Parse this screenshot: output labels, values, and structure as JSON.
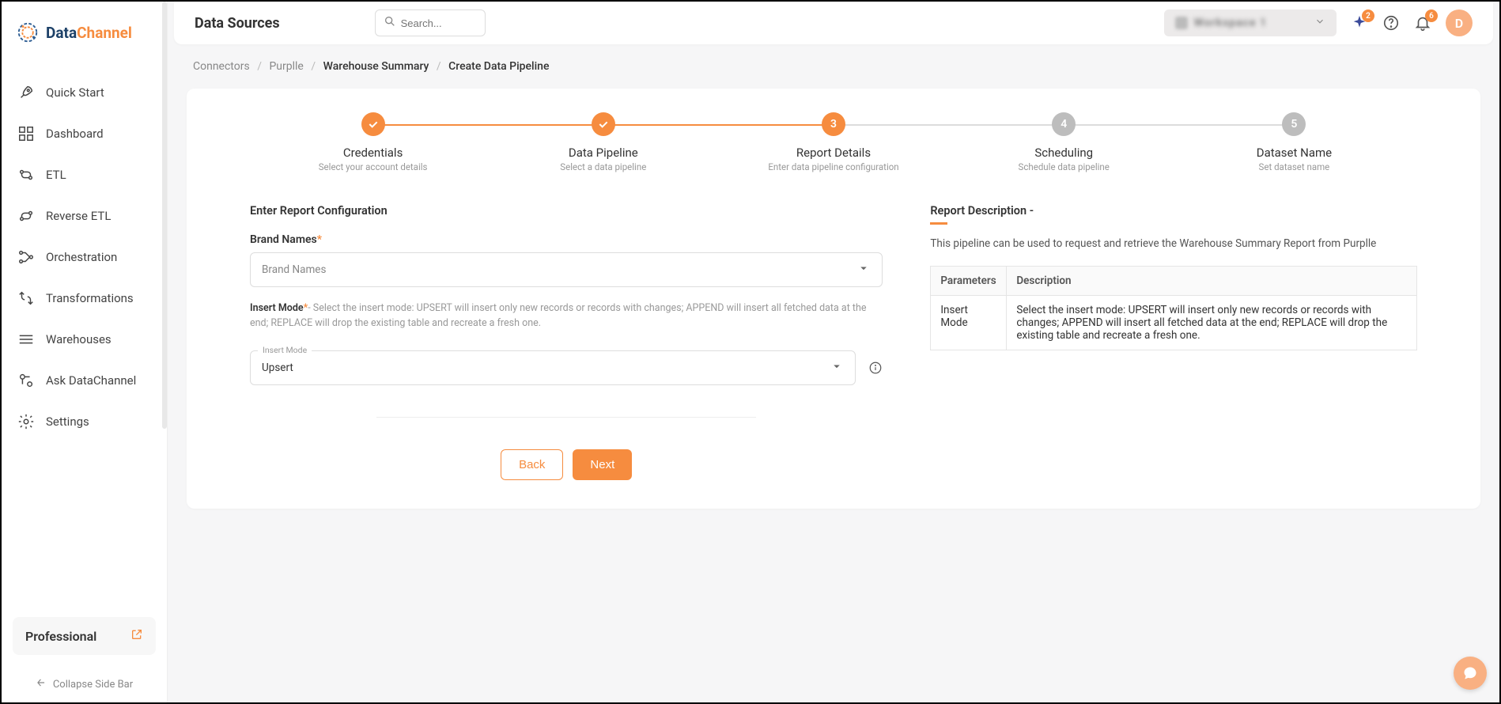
{
  "brand": {
    "first": "Data",
    "second": "Channel"
  },
  "sidebar": {
    "items": [
      {
        "label": "Quick Start"
      },
      {
        "label": "Dashboard"
      },
      {
        "label": "ETL"
      },
      {
        "label": "Reverse ETL"
      },
      {
        "label": "Orchestration"
      },
      {
        "label": "Transformations"
      },
      {
        "label": "Warehouses"
      },
      {
        "label": "Ask DataChannel"
      },
      {
        "label": "Settings"
      }
    ],
    "plan": "Professional",
    "collapse": "Collapse Side Bar"
  },
  "header": {
    "title": "Data Sources",
    "search_placeholder": "Search...",
    "workspace": "Workspace 1",
    "badge_sparkle": "2",
    "badge_bell": "6",
    "avatar_letter": "D"
  },
  "breadcrumbs": {
    "items": [
      "Connectors",
      "Purplle",
      "Warehouse Summary",
      "Create Data Pipeline"
    ]
  },
  "steps": [
    {
      "title": "Credentials",
      "sub": "Select your account details"
    },
    {
      "title": "Data Pipeline",
      "sub": "Select a data pipeline"
    },
    {
      "title": "Report Details",
      "sub": "Enter data pipeline configuration",
      "num": "3"
    },
    {
      "title": "Scheduling",
      "sub": "Schedule data pipeline",
      "num": "4"
    },
    {
      "title": "Dataset Name",
      "sub": "Set dataset name",
      "num": "5"
    }
  ],
  "form": {
    "section_title": "Enter Report Configuration",
    "brand_names_label": "Brand Names",
    "brand_names_placeholder": "Brand Names",
    "insert_mode_label": "Insert Mode",
    "insert_mode_help": "- Select the insert mode: UPSERT will insert only new records or records with changes; APPEND will insert all fetched data at the end; REPLACE will drop the existing table and recreate a fresh one.",
    "insert_mode_float": "Insert Mode",
    "insert_mode_value": "Upsert",
    "back": "Back",
    "next": "Next"
  },
  "report_desc": {
    "title": "Report Description -",
    "text": "This pipeline can be used to request and retrieve the Warehouse Summary Report from Purplle",
    "col_param": "Parameters",
    "col_desc": "Description",
    "row_param": "Insert Mode",
    "row_desc": "Select the insert mode: UPSERT will insert only new records or records with changes; APPEND will insert all fetched data at the end; REPLACE will drop the existing table and recreate a fresh one."
  }
}
